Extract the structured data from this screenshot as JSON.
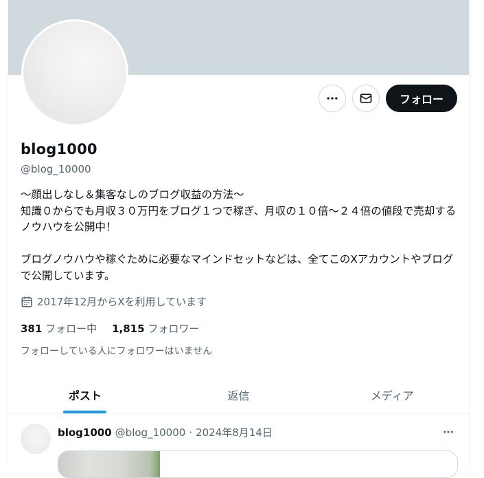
{
  "profile": {
    "name": "blog1000",
    "handle": "@blog_10000",
    "bio": "〜顔出しなし＆集客なしのブログ収益の方法〜\n知識０からでも月収３０万円をブログ１つで稼ぎ、月収の１０倍〜２４倍の値段で売却するノウハウを公開中！\n\nブログノウハウや稼ぐために必要なマインドセットなどは、全てこのXアカウントやブログで公開しています。",
    "joined": "2017年12月からXを利用しています",
    "following_count": "381",
    "following_label": "フォロー中",
    "followers_count": "1,815",
    "followers_label": "フォロワー",
    "not_followed_note": "フォローしている人にフォロワーはいません"
  },
  "actions": {
    "more_icon": "more-horizontal-icon",
    "message_icon": "mail-icon",
    "follow_label": "フォロー"
  },
  "tabs": [
    {
      "label": "ポスト",
      "active": true
    },
    {
      "label": "返信",
      "active": false
    },
    {
      "label": "メディア",
      "active": false
    }
  ],
  "post": {
    "name": "blog1000",
    "handle": "@blog_10000",
    "separator": "·",
    "date": "2024年8月14日"
  },
  "colors": {
    "banner": "#cfd9de",
    "accent": "#1d9bf0",
    "follow_button_bg": "#0f1419",
    "text_secondary": "#536471"
  }
}
